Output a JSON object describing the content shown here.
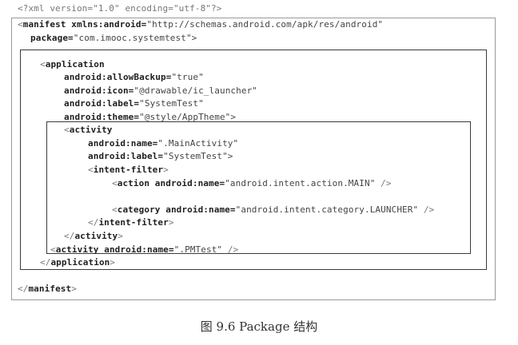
{
  "code": {
    "l01": {
      "a": "<?xml version=\"1.0\" encoding=\"utf-8\"?>"
    },
    "l02": {
      "a": "<",
      "b": "manifest xmlns:android=",
      "c": "\"http://schemas.android.com/apk/res/android\""
    },
    "l03": {
      "b": "package=",
      "c": "\"com.imooc.systemtest\">"
    },
    "l04": {
      "a": "<",
      "b": "application"
    },
    "l05": {
      "b": "android:allowBackup=",
      "c": "\"true\""
    },
    "l06": {
      "b": "android:icon=",
      "c": "\"@drawable/ic_launcher\""
    },
    "l07": {
      "b": "android:label=",
      "c": "\"SystemTest\""
    },
    "l08": {
      "b": "android:theme=",
      "c": "\"@style/AppTheme\">"
    },
    "l09": {
      "a": "<",
      "b": "activity"
    },
    "l10": {
      "b": "android:name=",
      "c": "\".MainActivity\""
    },
    "l11": {
      "b": "android:label=",
      "c": "\"SystemTest\">"
    },
    "l12": {
      "a": "<",
      "b": "intent-filter",
      "d": ">"
    },
    "l13": {
      "a": "<",
      "b": "action android:name=",
      "c": "\"android.intent.action.MAIN\"",
      "d": " />"
    },
    "l14": {
      "a": "<",
      "b": "category android:name=",
      "c": "\"android.intent.category.LAUNCHER\"",
      "d": " />"
    },
    "l15": {
      "a": "</",
      "b": "intent-filter",
      "d": ">"
    },
    "l16": {
      "a": "</",
      "b": "activity",
      "d": ">"
    },
    "l17": {
      "a": "<",
      "b": "activity android:name=",
      "c": "\".PMTest\"",
      "d": " />"
    },
    "l18": {
      "a": "</",
      "b": "application",
      "d": ">"
    },
    "l19": {
      "a": "</",
      "b": "manifest",
      "d": ">"
    }
  },
  "caption": "图 9.6    Package 结构"
}
